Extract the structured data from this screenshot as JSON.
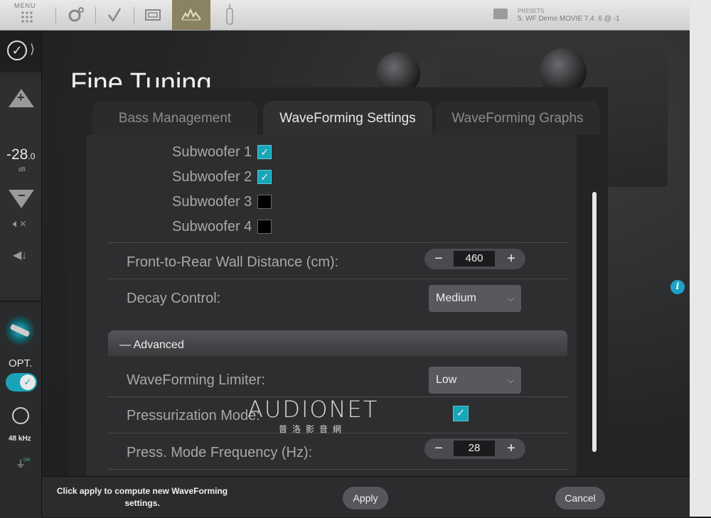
{
  "topbar": {
    "menu_label": "MENU",
    "presets_label": "PRESETS",
    "preset_value": "5. WF Demo MOVIE 7.4 .6 @ -1"
  },
  "sidebar": {
    "volume": "-28",
    "volume_decimal": ".0",
    "volume_unit": "dB",
    "input_label": "OPT.",
    "sample_rate": "48 kHz",
    "on_label": "ON"
  },
  "page_title": "Fine Tuning",
  "tabs": [
    {
      "label": "Bass Management",
      "active": false
    },
    {
      "label": "WaveForming Settings",
      "active": true
    },
    {
      "label": "WaveForming Graphs",
      "active": false
    }
  ],
  "subwoofers": [
    {
      "label": "Subwoofer 1",
      "checked": true
    },
    {
      "label": "Subwoofer 2",
      "checked": true
    },
    {
      "label": "Subwoofer 3",
      "checked": false
    },
    {
      "label": "Subwoofer 4",
      "checked": false
    }
  ],
  "settings": {
    "wall_distance_label": "Front-to-Rear Wall Distance (cm):",
    "wall_distance_value": "460",
    "decay_label": "Decay Control:",
    "decay_value": "Medium",
    "advanced_label": "— Advanced",
    "limiter_label": "WaveForming Limiter:",
    "limiter_value": "Low",
    "pressurization_label": "Pressurization Mode:",
    "pressurization_checked": true,
    "press_freq_label": "Press. Mode Frequency (Hz):",
    "press_freq_value": "28"
  },
  "stepper": {
    "minus": "−",
    "plus": "+"
  },
  "footer": {
    "message": "Click apply to compute new WaveForming settings.",
    "apply_label": "Apply",
    "cancel_label": "Cancel"
  },
  "watermark": {
    "brand": "AUDIONET",
    "sub": "普洛影音網"
  },
  "colors": {
    "accent": "#18a6b9",
    "active_tab_bg": "#303133",
    "topbar_active": "#8a8260"
  }
}
